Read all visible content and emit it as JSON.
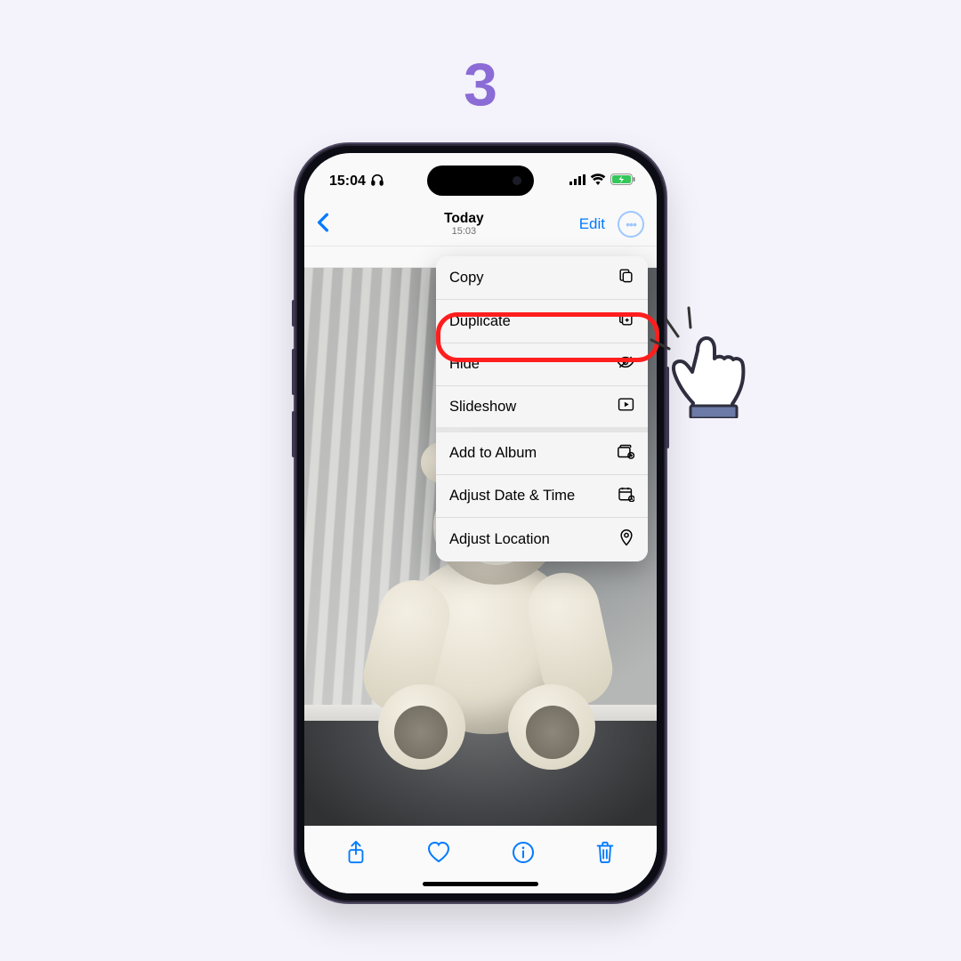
{
  "step": "3",
  "status": {
    "time": "15:04",
    "headphones": true,
    "battery_charging": true
  },
  "nav": {
    "title": "Today",
    "subtitle": "15:03",
    "edit": "Edit"
  },
  "menu": {
    "items": [
      {
        "label": "Copy",
        "icon": "copy-icon",
        "highlighted": false
      },
      {
        "label": "Duplicate",
        "icon": "duplicate-icon",
        "highlighted": false
      },
      {
        "label": "Hide",
        "icon": "eye-off-icon",
        "highlighted": true
      },
      {
        "label": "Slideshow",
        "icon": "play-rect-icon",
        "highlighted": false
      },
      {
        "label": "Add to Album",
        "icon": "album-add-icon",
        "highlighted": false
      },
      {
        "label": "Adjust Date & Time",
        "icon": "calendar-icon",
        "highlighted": false
      },
      {
        "label": "Adjust Location",
        "icon": "location-pin-icon",
        "highlighted": false
      }
    ],
    "gaps_after": [
      3
    ]
  },
  "toolbar": {
    "items": [
      "share-icon",
      "heart-icon",
      "info-icon",
      "trash-icon"
    ]
  },
  "photo_subject": "Plush teddy bear sitting on a window sill beside a curtain",
  "colors": {
    "accent": "#007aff",
    "step": "#8b6bd6",
    "highlight": "#ff1e1e"
  }
}
